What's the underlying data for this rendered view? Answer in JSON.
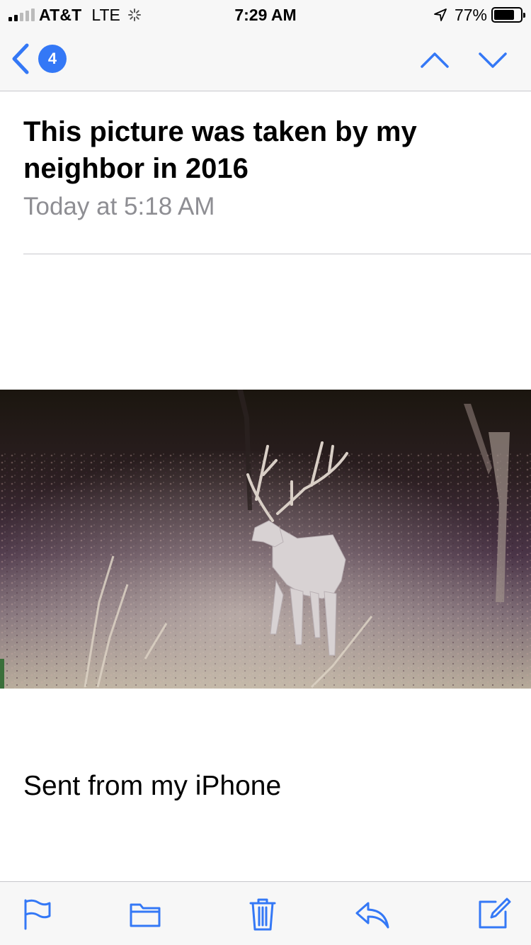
{
  "status_bar": {
    "carrier": "AT&T",
    "network": "LTE",
    "time": "7:29 AM",
    "battery_percent": "77%",
    "battery_level": 0.77
  },
  "nav": {
    "unread_count": "4",
    "accent_color": "#3478f6",
    "icons": [
      "chevron-left-icon",
      "chevron-up-icon",
      "chevron-down-icon"
    ]
  },
  "message": {
    "subject": "This picture was taken by my neighbor in 2016",
    "date": "Today at 5:18 AM",
    "signature": "Sent from my iPhone"
  },
  "toolbar": {
    "icons": [
      "flag-icon",
      "folder-icon",
      "trash-icon",
      "reply-icon",
      "compose-icon"
    ]
  }
}
